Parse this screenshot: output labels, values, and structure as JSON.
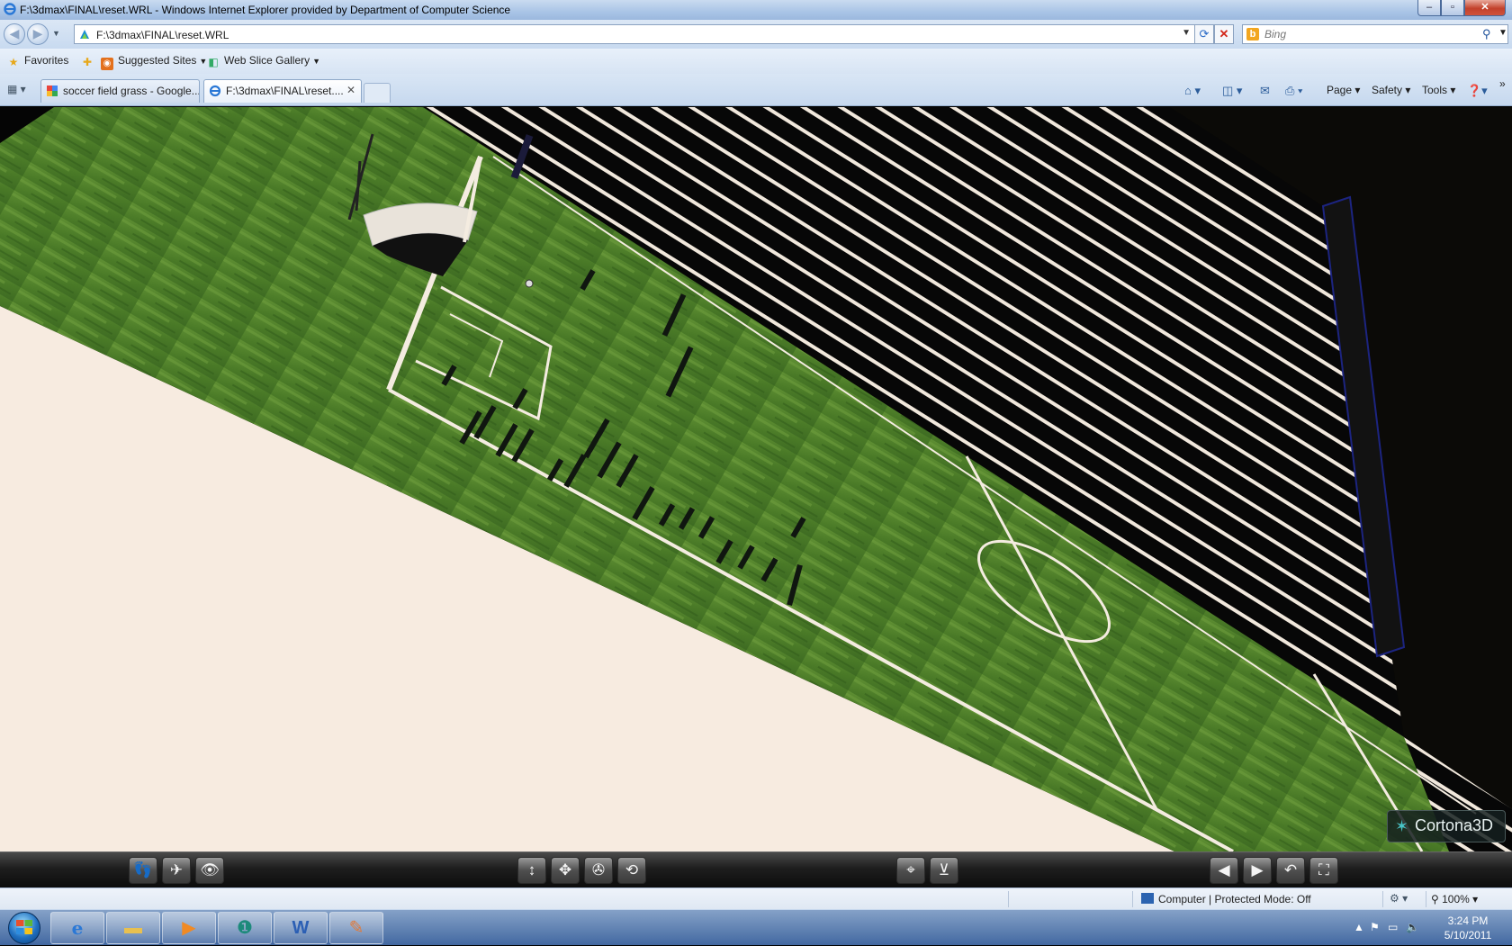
{
  "window": {
    "title": "F:\\3dmax\\FINAL\\reset.WRL - Windows Internet Explorer provided by Department of Computer Science",
    "minimize": "–",
    "maximize": "▫",
    "close": "✕"
  },
  "nav": {
    "back": "◀",
    "forward": "▶",
    "url": "F:\\3dmax\\FINAL\\reset.WRL",
    "search_placeholder": "Bing",
    "bing_icon": "b"
  },
  "favorites": {
    "favorites_label": "Favorites",
    "suggested_sites": "Suggested Sites",
    "web_slice_gallery": "Web Slice Gallery"
  },
  "tabs": [
    {
      "label": "soccer field grass - Google..."
    },
    {
      "label": "F:\\3dmax\\FINAL\\reset...."
    }
  ],
  "command_bar": {
    "page": "Page",
    "safety": "Safety",
    "tools": "Tools"
  },
  "viewer": {
    "logo_text": "Cortona3D"
  },
  "cortona_toolbar": {
    "left_group": [
      "walk-icon",
      "fly-icon",
      "study-icon"
    ],
    "middle_group": [
      "slide-icon",
      "pan-icon",
      "turn-icon",
      "roll-icon"
    ],
    "center_group": [
      "goto-icon",
      "align-icon"
    ],
    "right_group": [
      "prev-viewpoint-icon",
      "next-viewpoint-icon",
      "restore-icon",
      "fit-icon"
    ]
  },
  "status": {
    "zone": "Computer | Protected Mode: Off",
    "zoom": "100%"
  },
  "taskbar": {
    "apps": [
      "internet-explorer-icon",
      "explorer-folder-icon",
      "media-player-icon",
      "3ds-max-icon",
      "word-icon",
      "paint-icon"
    ],
    "time": "3:24 PM",
    "date": "5/10/2011"
  },
  "colors": {
    "grass": "#4f7f2a",
    "line": "#f4ece0",
    "stand_dark": "#070707",
    "ground_cream": "#f7ebe0",
    "player": "#101610"
  }
}
